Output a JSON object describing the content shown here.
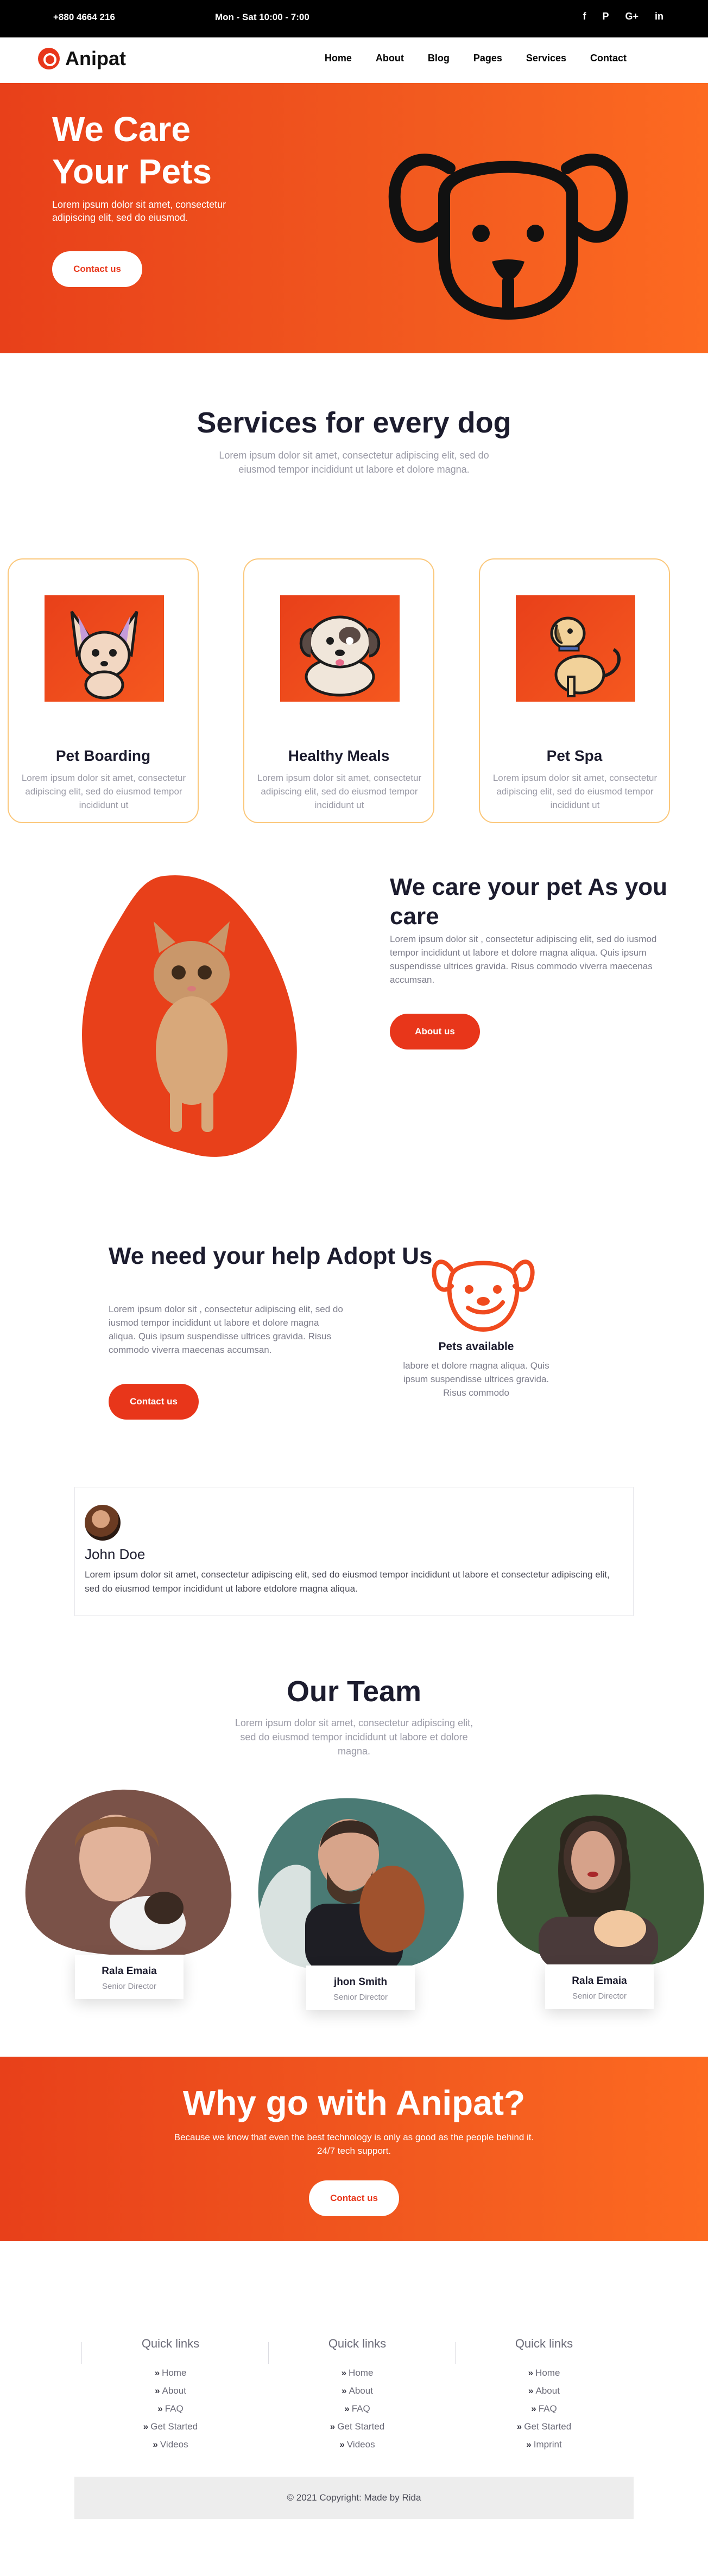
{
  "topbar": {
    "phone": "+880 4664 216",
    "hours": "Mon - Sat 10:00 - 7:00",
    "social_icons": [
      "facebook-icon",
      "pinterest-icon",
      "google-plus-icon",
      "linkedin-icon"
    ],
    "social_glyphs": [
      "f",
      "P",
      "G+",
      "in"
    ]
  },
  "brand": {
    "name": "Anipat",
    "accent": "#e8361a"
  },
  "nav": {
    "items": [
      "Home",
      "About",
      "Blog",
      "Pages",
      "Services",
      "Contact"
    ]
  },
  "hero": {
    "title": "We Care Your Pets",
    "text": "Lorem ipsum dolor sit amet, consectetur adipiscing elit, sed do eiusmod.",
    "cta": "Contact us"
  },
  "services": {
    "title": "Services for every dog",
    "subtitle": "Lorem ipsum dolor sit amet, consectetur adipiscing elit, sed do eiusmod tempor incididunt ut labore et dolore magna.",
    "cards": [
      {
        "title": "Pet Boarding",
        "text": "Lorem ipsum dolor sit amet, consectetur adipiscing elit, sed do eiusmod tempor incididunt ut"
      },
      {
        "title": "Healthy Meals",
        "text": "Lorem ipsum dolor sit amet, consectetur adipiscing elit, sed do eiusmod tempor incididunt ut"
      },
      {
        "title": "Pet Spa",
        "text": "Lorem ipsum dolor sit amet, consectetur adipiscing elit, sed do eiusmod tempor incididunt ut"
      }
    ]
  },
  "care": {
    "title": "We care your pet As you care",
    "text": "Lorem ipsum dolor sit , consectetur adipiscing elit, sed do iusmod tempor incididunt ut labore et dolore magna aliqua. Quis ipsum suspendisse ultrices gravida. Risus commodo viverra maecenas accumsan.",
    "cta": "About us"
  },
  "adopt": {
    "title": "We need your help Adopt Us",
    "text": "Lorem ipsum dolor sit , consectetur adipiscing elit, sed do iusmod tempor incididunt ut labore et dolore magna aliqua. Quis ipsum suspendisse ultrices gravida. Risus commodo viverra maecenas accumsan.",
    "cta": "Contact us",
    "pets_title": "Pets available",
    "pets_text": "labore et dolore magna aliqua. Quis ipsum suspendisse ultrices gravida. Risus commodo"
  },
  "testimonial": {
    "name": "John Doe",
    "text": "Lorem ipsum dolor sit amet, consectetur adipiscing elit, sed do eiusmod tempor incididunt ut labore et consectetur adipiscing elit, sed do eiusmod tempor incididunt ut labore etdolore magna aliqua."
  },
  "team": {
    "title": "Our Team",
    "subtitle": "Lorem ipsum dolor sit amet, consectetur adipiscing elit, sed do eiusmod tempor incididunt ut labore et dolore magna.",
    "members": [
      {
        "name": "Rala Emaia",
        "role": "Senior Director"
      },
      {
        "name": "jhon Smith",
        "role": "Senior Director"
      },
      {
        "name": "Rala Emaia",
        "role": "Senior Director"
      }
    ]
  },
  "why": {
    "title": "Why go with Anipat?",
    "text": "Because we know that even the best technology is only as good as the people behind it. 24/7 tech support.",
    "cta": "Contact us"
  },
  "footer": {
    "columns": [
      {
        "title": "Quick links",
        "links": [
          "Home",
          "About",
          "FAQ",
          "Get Started",
          "Videos"
        ]
      },
      {
        "title": "Quick links",
        "links": [
          "Home",
          "About",
          "FAQ",
          "Get Started",
          "Videos"
        ]
      },
      {
        "title": "Quick links",
        "links": [
          "Home",
          "About",
          "FAQ",
          "Get Started",
          "Imprint"
        ]
      }
    ],
    "copyright": "© 2021 Copyright: Made by Rida"
  }
}
